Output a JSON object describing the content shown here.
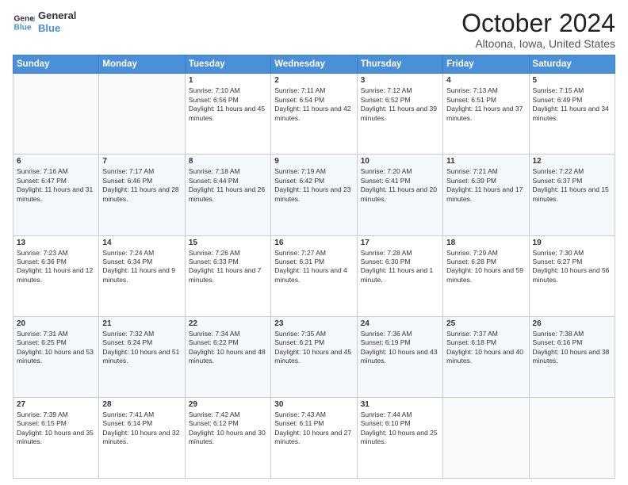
{
  "logo": {
    "line1": "General",
    "line2": "Blue"
  },
  "header": {
    "month": "October 2024",
    "location": "Altoona, Iowa, United States"
  },
  "weekdays": [
    "Sunday",
    "Monday",
    "Tuesday",
    "Wednesday",
    "Thursday",
    "Friday",
    "Saturday"
  ],
  "weeks": [
    [
      {
        "day": "",
        "sunrise": "",
        "sunset": "",
        "daylight": ""
      },
      {
        "day": "",
        "sunrise": "",
        "sunset": "",
        "daylight": ""
      },
      {
        "day": "1",
        "sunrise": "Sunrise: 7:10 AM",
        "sunset": "Sunset: 6:56 PM",
        "daylight": "Daylight: 11 hours and 45 minutes."
      },
      {
        "day": "2",
        "sunrise": "Sunrise: 7:11 AM",
        "sunset": "Sunset: 6:54 PM",
        "daylight": "Daylight: 11 hours and 42 minutes."
      },
      {
        "day": "3",
        "sunrise": "Sunrise: 7:12 AM",
        "sunset": "Sunset: 6:52 PM",
        "daylight": "Daylight: 11 hours and 39 minutes."
      },
      {
        "day": "4",
        "sunrise": "Sunrise: 7:13 AM",
        "sunset": "Sunset: 6:51 PM",
        "daylight": "Daylight: 11 hours and 37 minutes."
      },
      {
        "day": "5",
        "sunrise": "Sunrise: 7:15 AM",
        "sunset": "Sunset: 6:49 PM",
        "daylight": "Daylight: 11 hours and 34 minutes."
      }
    ],
    [
      {
        "day": "6",
        "sunrise": "Sunrise: 7:16 AM",
        "sunset": "Sunset: 6:47 PM",
        "daylight": "Daylight: 11 hours and 31 minutes."
      },
      {
        "day": "7",
        "sunrise": "Sunrise: 7:17 AM",
        "sunset": "Sunset: 6:46 PM",
        "daylight": "Daylight: 11 hours and 28 minutes."
      },
      {
        "day": "8",
        "sunrise": "Sunrise: 7:18 AM",
        "sunset": "Sunset: 6:44 PM",
        "daylight": "Daylight: 11 hours and 26 minutes."
      },
      {
        "day": "9",
        "sunrise": "Sunrise: 7:19 AM",
        "sunset": "Sunset: 6:42 PM",
        "daylight": "Daylight: 11 hours and 23 minutes."
      },
      {
        "day": "10",
        "sunrise": "Sunrise: 7:20 AM",
        "sunset": "Sunset: 6:41 PM",
        "daylight": "Daylight: 11 hours and 20 minutes."
      },
      {
        "day": "11",
        "sunrise": "Sunrise: 7:21 AM",
        "sunset": "Sunset: 6:39 PM",
        "daylight": "Daylight: 11 hours and 17 minutes."
      },
      {
        "day": "12",
        "sunrise": "Sunrise: 7:22 AM",
        "sunset": "Sunset: 6:37 PM",
        "daylight": "Daylight: 11 hours and 15 minutes."
      }
    ],
    [
      {
        "day": "13",
        "sunrise": "Sunrise: 7:23 AM",
        "sunset": "Sunset: 6:36 PM",
        "daylight": "Daylight: 11 hours and 12 minutes."
      },
      {
        "day": "14",
        "sunrise": "Sunrise: 7:24 AM",
        "sunset": "Sunset: 6:34 PM",
        "daylight": "Daylight: 11 hours and 9 minutes."
      },
      {
        "day": "15",
        "sunrise": "Sunrise: 7:26 AM",
        "sunset": "Sunset: 6:33 PM",
        "daylight": "Daylight: 11 hours and 7 minutes."
      },
      {
        "day": "16",
        "sunrise": "Sunrise: 7:27 AM",
        "sunset": "Sunset: 6:31 PM",
        "daylight": "Daylight: 11 hours and 4 minutes."
      },
      {
        "day": "17",
        "sunrise": "Sunrise: 7:28 AM",
        "sunset": "Sunset: 6:30 PM",
        "daylight": "Daylight: 11 hours and 1 minute."
      },
      {
        "day": "18",
        "sunrise": "Sunrise: 7:29 AM",
        "sunset": "Sunset: 6:28 PM",
        "daylight": "Daylight: 10 hours and 59 minutes."
      },
      {
        "day": "19",
        "sunrise": "Sunrise: 7:30 AM",
        "sunset": "Sunset: 6:27 PM",
        "daylight": "Daylight: 10 hours and 56 minutes."
      }
    ],
    [
      {
        "day": "20",
        "sunrise": "Sunrise: 7:31 AM",
        "sunset": "Sunset: 6:25 PM",
        "daylight": "Daylight: 10 hours and 53 minutes."
      },
      {
        "day": "21",
        "sunrise": "Sunrise: 7:32 AM",
        "sunset": "Sunset: 6:24 PM",
        "daylight": "Daylight: 10 hours and 51 minutes."
      },
      {
        "day": "22",
        "sunrise": "Sunrise: 7:34 AM",
        "sunset": "Sunset: 6:22 PM",
        "daylight": "Daylight: 10 hours and 48 minutes."
      },
      {
        "day": "23",
        "sunrise": "Sunrise: 7:35 AM",
        "sunset": "Sunset: 6:21 PM",
        "daylight": "Daylight: 10 hours and 45 minutes."
      },
      {
        "day": "24",
        "sunrise": "Sunrise: 7:36 AM",
        "sunset": "Sunset: 6:19 PM",
        "daylight": "Daylight: 10 hours and 43 minutes."
      },
      {
        "day": "25",
        "sunrise": "Sunrise: 7:37 AM",
        "sunset": "Sunset: 6:18 PM",
        "daylight": "Daylight: 10 hours and 40 minutes."
      },
      {
        "day": "26",
        "sunrise": "Sunrise: 7:38 AM",
        "sunset": "Sunset: 6:16 PM",
        "daylight": "Daylight: 10 hours and 38 minutes."
      }
    ],
    [
      {
        "day": "27",
        "sunrise": "Sunrise: 7:39 AM",
        "sunset": "Sunset: 6:15 PM",
        "daylight": "Daylight: 10 hours and 35 minutes."
      },
      {
        "day": "28",
        "sunrise": "Sunrise: 7:41 AM",
        "sunset": "Sunset: 6:14 PM",
        "daylight": "Daylight: 10 hours and 32 minutes."
      },
      {
        "day": "29",
        "sunrise": "Sunrise: 7:42 AM",
        "sunset": "Sunset: 6:12 PM",
        "daylight": "Daylight: 10 hours and 30 minutes."
      },
      {
        "day": "30",
        "sunrise": "Sunrise: 7:43 AM",
        "sunset": "Sunset: 6:11 PM",
        "daylight": "Daylight: 10 hours and 27 minutes."
      },
      {
        "day": "31",
        "sunrise": "Sunrise: 7:44 AM",
        "sunset": "Sunset: 6:10 PM",
        "daylight": "Daylight: 10 hours and 25 minutes."
      },
      {
        "day": "",
        "sunrise": "",
        "sunset": "",
        "daylight": ""
      },
      {
        "day": "",
        "sunrise": "",
        "sunset": "",
        "daylight": ""
      }
    ]
  ]
}
